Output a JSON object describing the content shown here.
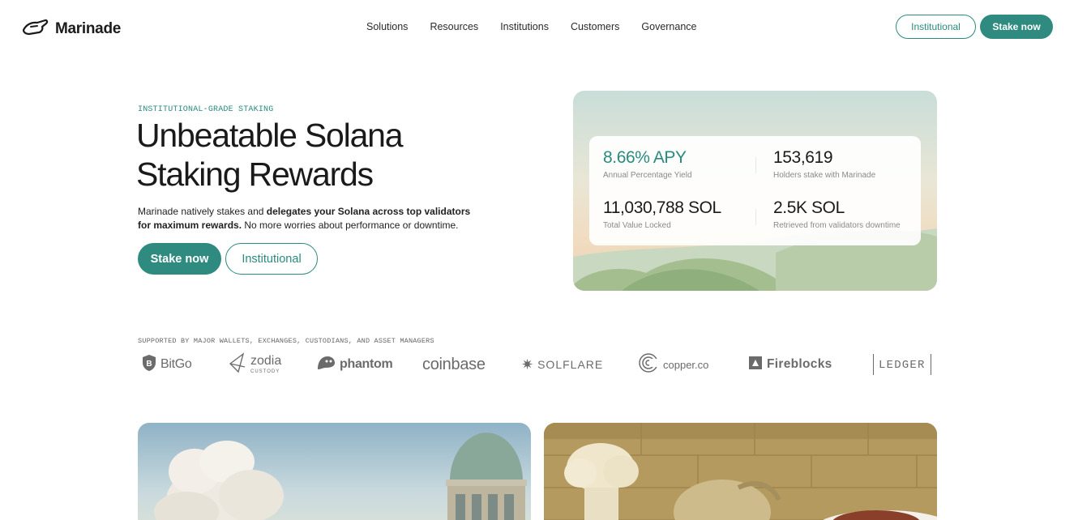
{
  "nav": {
    "brand": "Marinade",
    "links": [
      "Solutions",
      "Resources",
      "Institutions",
      "Customers",
      "Governance"
    ],
    "institutional_label": "Institutional",
    "stake_label": "Stake now"
  },
  "hero": {
    "eyebrow": "INSTITUTIONAL-GRADE STAKING",
    "headline_line1": "Unbeatable Solana",
    "headline_line2": "Staking Rewards",
    "desc_part1": "Marinade natively stakes and ",
    "desc_bold1": "delegates your Solana across top validators for maximum rewards.",
    "desc_part2": " No more worries about performance or downtime.",
    "stake_button": "Stake now",
    "institutional_button": "Institutional"
  },
  "stats": [
    {
      "value": "8.66% APY",
      "label": "Annual Percentage Yield"
    },
    {
      "value": "153,619",
      "label": "Holders stake with Marinade"
    },
    {
      "value": "11,030,788 SOL",
      "label": "Total Value Locked"
    },
    {
      "value": "2.5K SOL",
      "label": "Retrieved from validators downtime"
    }
  ],
  "partners": {
    "caption": "SUPPORTED BY MAJOR WALLETS, EXCHANGES, CUSTODIANS, AND ASSET MANAGERS",
    "names": [
      "BitGo",
      "zodia",
      "CUSTODY",
      "phantom",
      "coinbase",
      "SOLFLARE",
      "copper.co",
      "Fireblocks",
      "LEDGER"
    ]
  },
  "colors": {
    "accent": "#2b8a7e",
    "accent_fill": "#2f8a80"
  }
}
